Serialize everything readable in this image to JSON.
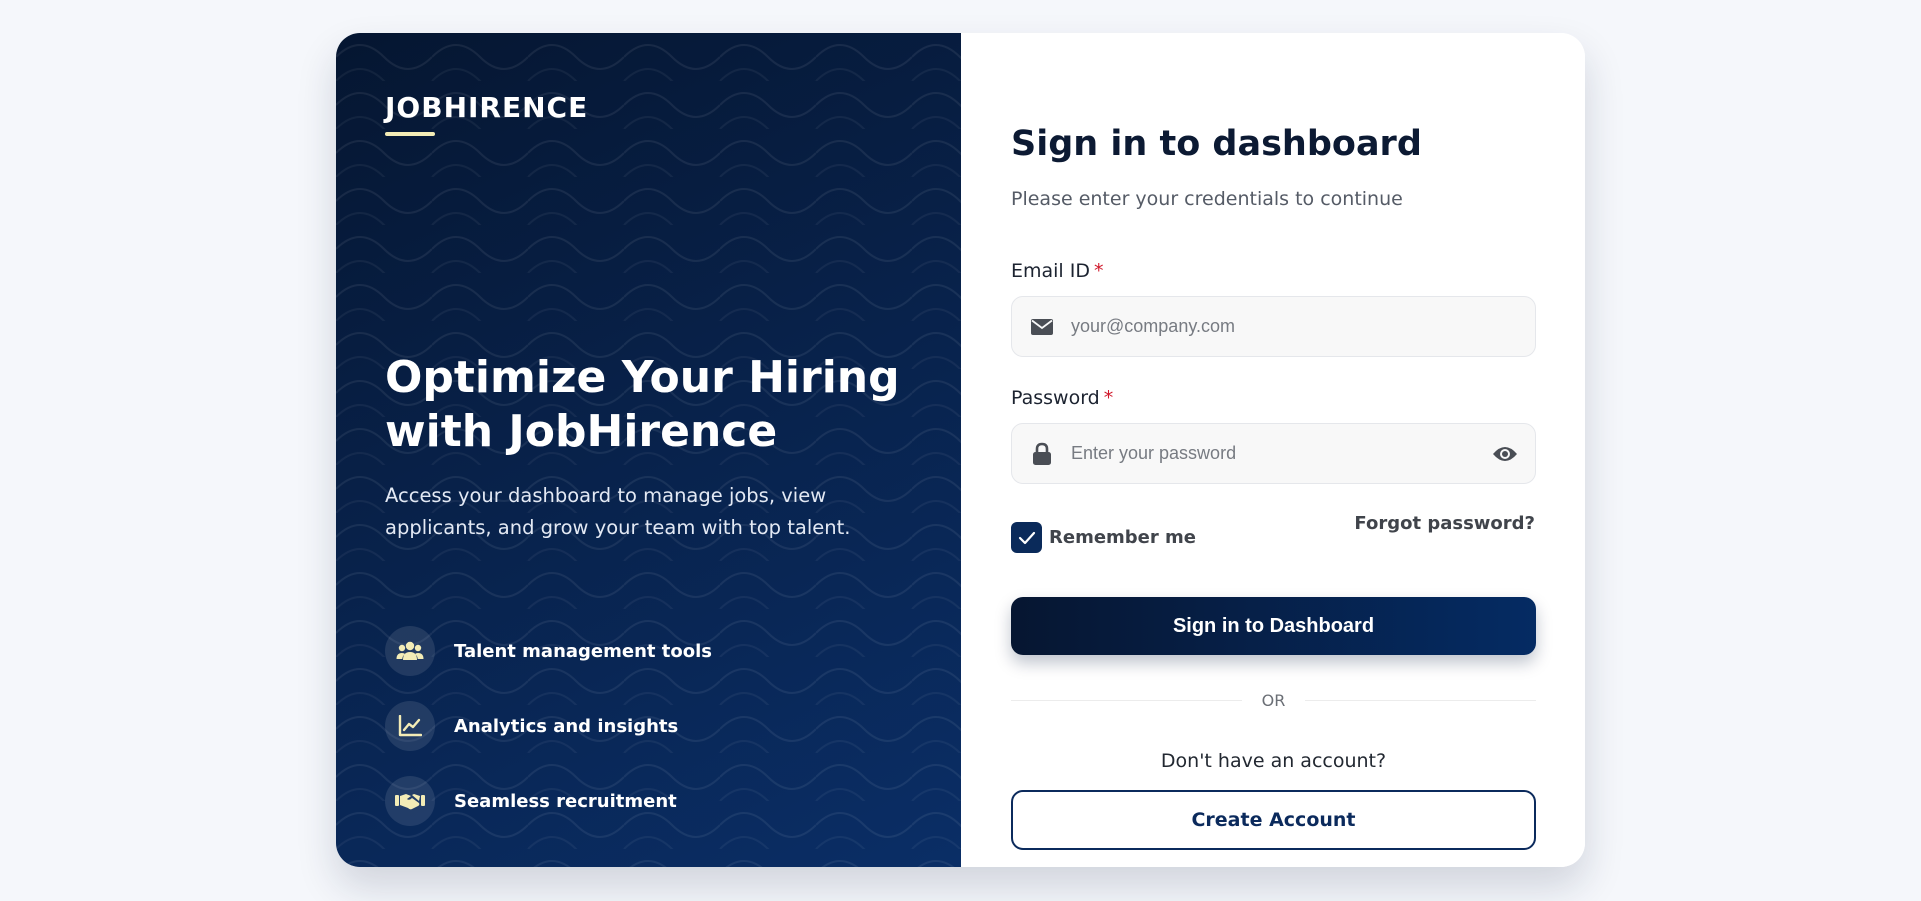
{
  "brand": {
    "name": "JOBHIRENCE",
    "accent_color": "#f3ecb6"
  },
  "hero": {
    "title": "Optimize Your Hiring with JobHirence",
    "subtitle": "Access your dashboard to manage jobs, view applicants, and grow your team with top talent."
  },
  "features": [
    {
      "label": "Talent management tools",
      "icon": "users-icon"
    },
    {
      "label": "Analytics and insights",
      "icon": "chart-line-icon"
    },
    {
      "label": "Seamless recruitment",
      "icon": "handshake-icon"
    }
  ],
  "form": {
    "title": "Sign in to dashboard",
    "subtitle": "Please enter your credentials to continue",
    "email": {
      "label": "Email ID",
      "required_mark": "*",
      "placeholder": "your@company.com",
      "value": "",
      "icon": "envelope-icon"
    },
    "password": {
      "label": "Password",
      "required_mark": "*",
      "placeholder": "Enter your password",
      "value": "",
      "icon": "lock-icon"
    },
    "remember_label": "Remember me",
    "remember_checked": true,
    "forgot_label": "Forgot password?",
    "submit_label": "Sign in to Dashboard",
    "divider_label": "OR",
    "no_account_text": "Don't have an account?",
    "create_label": "Create Account"
  },
  "colors": {
    "primary": "#0a2a5a",
    "panel_dark": "#051631",
    "required": "#d0182b"
  }
}
